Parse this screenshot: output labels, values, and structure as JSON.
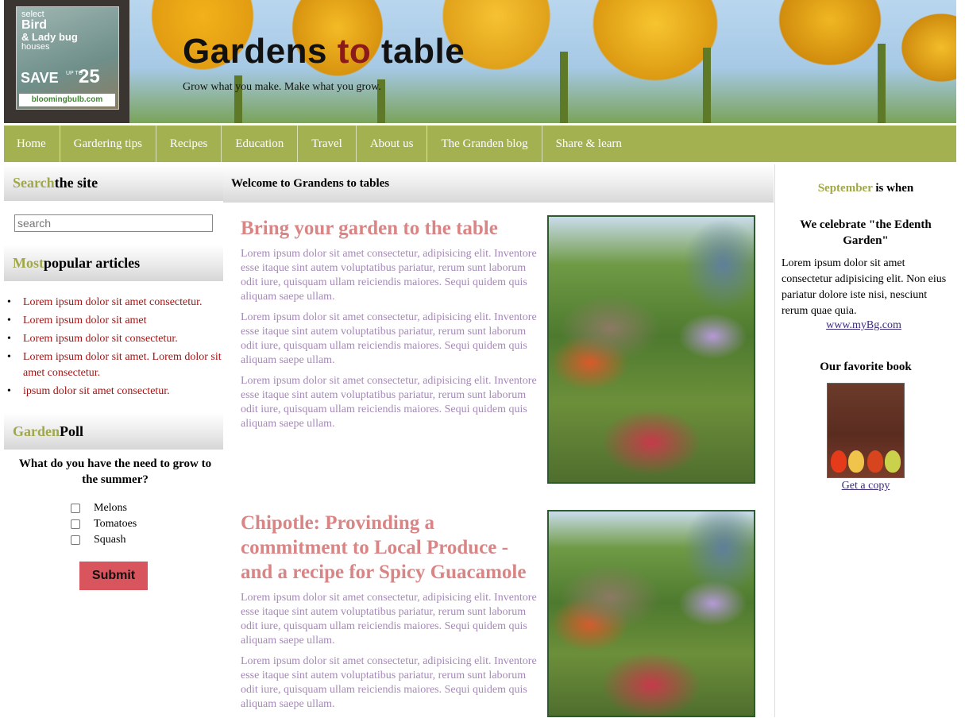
{
  "header": {
    "ad": {
      "line1": "select",
      "line2": "Bird",
      "line3": "& Lady bug",
      "line4": "houses",
      "save": "SAVE",
      "upto": "UP TO",
      "percent": "25",
      "logo": "bloomingbulb.com"
    },
    "title_part1": "Gardens ",
    "title_part2": "to",
    "title_part3": " table",
    "tagline": "Grow what you make. Make what you grow."
  },
  "nav": {
    "items": [
      {
        "label": "Home"
      },
      {
        "label": "Gardering tips"
      },
      {
        "label": "Recipes"
      },
      {
        "label": "Education"
      },
      {
        "label": "Travel"
      },
      {
        "label": "About us"
      },
      {
        "label": "The Granden blog"
      },
      {
        "label": "Share & learn"
      }
    ]
  },
  "left": {
    "search": {
      "accent": "Search",
      "rest": " the site",
      "placeholder": "search"
    },
    "popular": {
      "accent": "Most",
      "rest": " popular articles",
      "items": [
        "Lorem ipsum dolor sit amet consectetur.",
        "Lorem ipsum dolor sit amet",
        "Lorem ipsum dolor sit consectetur.",
        "Lorem ipsum dolor sit amet. Lorem dolor sit amet consectetur.",
        "ipsum dolor sit amet consectetur."
      ]
    },
    "poll": {
      "accent": "Garden",
      "rest": " Poll",
      "question": "What do you have the need to grow to the summer?",
      "options": [
        "Melons",
        "Tomatoes",
        "Squash"
      ],
      "submit": "Submit"
    }
  },
  "main": {
    "heading": "Welcome to Grandens to tables",
    "articles": [
      {
        "title": "Bring your garden to the table",
        "paragraphs": [
          "Lorem ipsum dolor sit amet consectetur, adipisicing elit. Inventore esse itaque sint autem voluptatibus pariatur, rerum sunt laborum odit iure, quisquam ullam reiciendis maiores. Sequi quidem quis aliquam saepe ullam.",
          "Lorem ipsum dolor sit amet consectetur, adipisicing elit. Inventore esse itaque sint autem voluptatibus pariatur, rerum sunt laborum odit iure, quisquam ullam reiciendis maiores. Sequi quidem quis aliquam saepe ullam.",
          "Lorem ipsum dolor sit amet consectetur, adipisicing elit. Inventore esse itaque sint autem voluptatibus pariatur, rerum sunt laborum odit iure, quisquam ullam reiciendis maiores. Sequi quidem quis aliquam saepe ullam."
        ]
      },
      {
        "title": "Chipotle: Provinding a commitment to Local Produce - and a recipe for Spicy Guacamole",
        "paragraphs": [
          "Lorem ipsum dolor sit amet consectetur, adipisicing elit. Inventore esse itaque sint autem voluptatibus pariatur, rerum sunt laborum odit iure, quisquam ullam reiciendis maiores. Sequi quidem quis aliquam saepe ullam.",
          "Lorem ipsum dolor sit amet consectetur, adipisicing elit. Inventore esse itaque sint autem voluptatibus pariatur, rerum sunt laborum odit iure, quisquam ullam reiciendis maiores. Sequi quidem quis aliquam saepe ullam."
        ]
      }
    ]
  },
  "right": {
    "title_accent": "September",
    "title_rest": " is when",
    "subtitle": "We celebrate \"the Edenth Garden\"",
    "body": "Lorem ipsum dolor sit amet consectetur adipisicing elit. Non eius pariatur dolore iste nisi, nesciunt rerum quae quia.",
    "link": "www.myBg.com",
    "book_heading": "Our favorite book",
    "book_link": "Get a copy"
  },
  "colors": {
    "nav_bg": "#a3b151",
    "accent_text": "#a0a84a",
    "article_title": "#d98585",
    "article_text": "#a588b8",
    "popular_link": "#a31414",
    "submit_bg": "#d9555d"
  }
}
